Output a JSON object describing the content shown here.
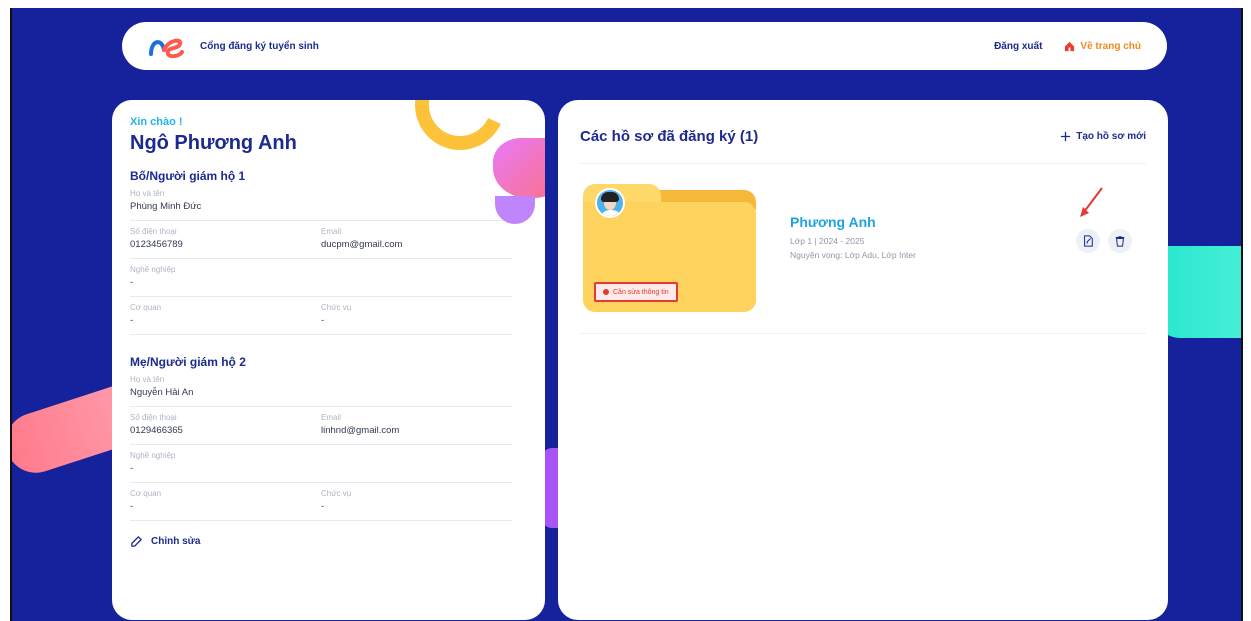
{
  "header": {
    "site_title": "Cổng đăng ký tuyển sinh",
    "logout_label": "Đăng xuất",
    "home_label": "Về trang chủ"
  },
  "left": {
    "greeting": "Xin chào !",
    "name": "Ngô Phương Anh",
    "guardian1": {
      "title": "Bố/Người giám hộ 1",
      "fullname_label": "Họ và tên",
      "fullname": "Phùng Minh Đức",
      "phone_label": "Số điện thoại",
      "phone": "0123456789",
      "email_label": "Email",
      "email": "ducpm@gmail.com",
      "job_label": "Nghề nghiệp",
      "job": "-",
      "org_label": "Cơ quan",
      "org": "-",
      "position_label": "Chức vụ",
      "position": "-"
    },
    "guardian2": {
      "title": "Mẹ/Người giám hộ 2",
      "fullname_label": "Họ và tên",
      "fullname": "Nguyễn Hải An",
      "phone_label": "Số điện thoại",
      "phone": "0129466365",
      "email_label": "Email",
      "email": "linhnd@gmail.com",
      "job_label": "Nghề nghiệp",
      "job": "-",
      "org_label": "Cơ quan",
      "org": "-",
      "position_label": "Chức vụ",
      "position": "-"
    },
    "edit_label": "Chỉnh sửa"
  },
  "right": {
    "title": "Các hồ sơ đã đăng ký (1)",
    "new_label": "Tạo hồ sơ mới",
    "profiles": [
      {
        "name": "Phương Anh",
        "meta": "Lớp 1 | 2024 - 2025",
        "wish": "Nguyện vọng: Lớp Adu, Lớp Inter",
        "status": "Cần sửa thông tin"
      }
    ]
  },
  "colors": {
    "background": "#16229b",
    "primary": "#1d2a8f",
    "accent": "#1fa3e0",
    "folder": "#fdd35e",
    "status": "#e53935",
    "home": "#f08a1c"
  },
  "icons": [
    "logo-icon",
    "home-icon",
    "pencil-icon",
    "plus-icon",
    "edit-icon",
    "trash-icon",
    "arrow-icon"
  ]
}
